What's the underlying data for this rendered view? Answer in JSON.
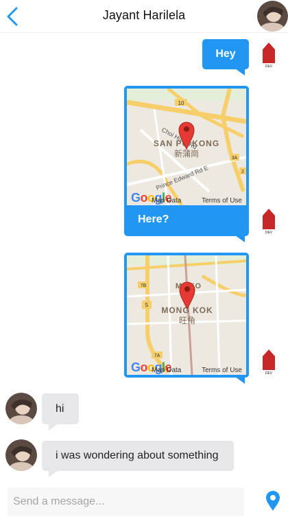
{
  "header": {
    "title": "Jayant Harilela",
    "back_icon": "chevron-left-icon",
    "accent": "#2196f3"
  },
  "messages": {
    "outgoing": [
      {
        "text": "Hey"
      },
      {
        "type": "map",
        "caption": "Here?",
        "place": "SAN PO KONG",
        "place_local": "新蒲崗",
        "street1": "Choi Hung Rd",
        "street2": "Prince Edward Rd E"
      },
      {
        "type": "map",
        "caption": "",
        "place": "MONG KOK",
        "place_local": "旺角",
        "area": "MOKO"
      }
    ],
    "incoming": [
      {
        "text": "hi"
      },
      {
        "text": "i was wondering about something"
      }
    ]
  },
  "map_labels": {
    "google": "Google",
    "map_data": "Map Data",
    "terms": "Terms of Use"
  },
  "badge": {
    "label": "DEV",
    "color": "#c62828"
  },
  "composer": {
    "placeholder": "Send a message...",
    "send_icon": "location-pin-icon"
  },
  "colors": {
    "bubble_out": "#2196f3",
    "bubble_in": "#e7e7ea"
  }
}
